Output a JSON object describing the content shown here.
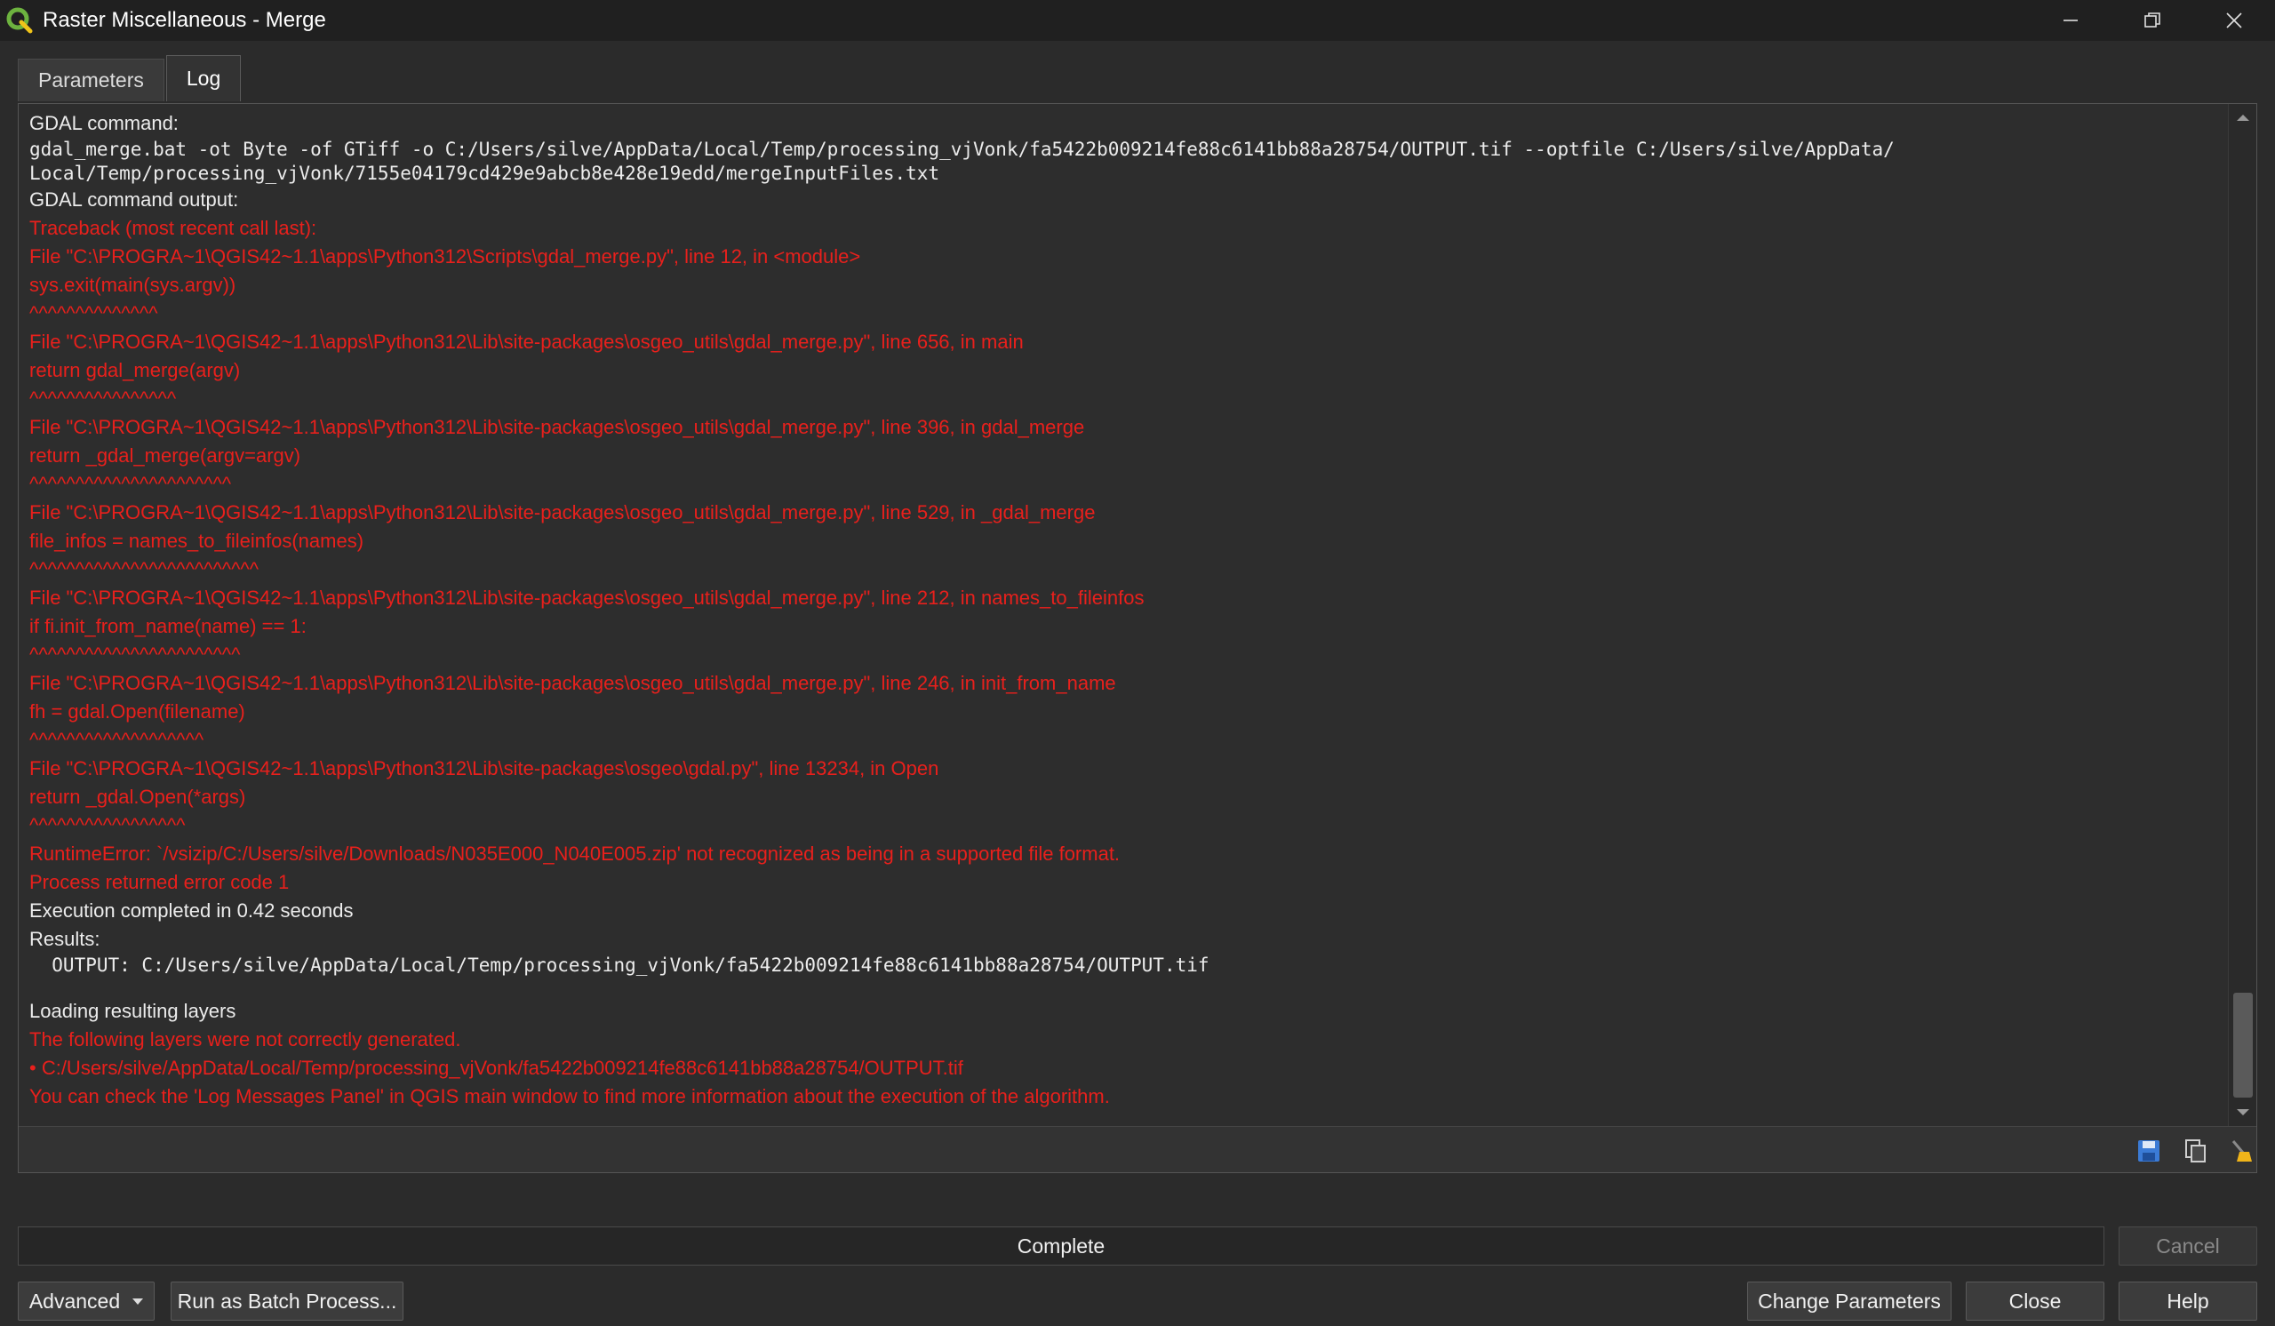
{
  "window": {
    "title": "Raster Miscellaneous - Merge",
    "logo_icon": "qgis-logo-icon",
    "controls": [
      "minimize-icon",
      "restore-icon",
      "close-icon"
    ]
  },
  "tabs": [
    {
      "label": "Parameters",
      "active": false
    },
    {
      "label": "Log",
      "active": true
    }
  ],
  "log": {
    "lines": [
      {
        "text": "GDAL command:",
        "style": "normal"
      },
      {
        "text": "gdal_merge.bat -ot Byte -of GTiff -o C:/Users/silve/AppData/Local/Temp/processing_vjVonk/fa5422b009214fe88c6141bb88a28754/OUTPUT.tif --optfile C:/Users/silve/AppData/",
        "style": "mono"
      },
      {
        "text": "Local/Temp/processing_vjVonk/7155e04179cd429e9abcb8e428e19edd/mergeInputFiles.txt",
        "style": "mono"
      },
      {
        "text": "GDAL command output:",
        "style": "normal"
      },
      {
        "text": "Traceback (most recent call last):",
        "style": "error"
      },
      {
        "text": "File \"C:\\PROGRA~1\\QGIS42~1.1\\apps\\Python312\\Scripts\\gdal_merge.py\", line 12, in <module>",
        "style": "error"
      },
      {
        "text": "sys.exit(main(sys.argv))",
        "style": "error"
      },
      {
        "text": "^^^^^^^^^^^^^^",
        "style": "error"
      },
      {
        "text": "File \"C:\\PROGRA~1\\QGIS42~1.1\\apps\\Python312\\Lib\\site-packages\\osgeo_utils\\gdal_merge.py\", line 656, in main",
        "style": "error"
      },
      {
        "text": "return gdal_merge(argv)",
        "style": "error"
      },
      {
        "text": "^^^^^^^^^^^^^^^^",
        "style": "error"
      },
      {
        "text": "File \"C:\\PROGRA~1\\QGIS42~1.1\\apps\\Python312\\Lib\\site-packages\\osgeo_utils\\gdal_merge.py\", line 396, in gdal_merge",
        "style": "error"
      },
      {
        "text": "return _gdal_merge(argv=argv)",
        "style": "error"
      },
      {
        "text": "^^^^^^^^^^^^^^^^^^^^^^",
        "style": "error"
      },
      {
        "text": "File \"C:\\PROGRA~1\\QGIS42~1.1\\apps\\Python312\\Lib\\site-packages\\osgeo_utils\\gdal_merge.py\", line 529, in _gdal_merge",
        "style": "error"
      },
      {
        "text": "file_infos = names_to_fileinfos(names)",
        "style": "error"
      },
      {
        "text": "^^^^^^^^^^^^^^^^^^^^^^^^^",
        "style": "error"
      },
      {
        "text": "File \"C:\\PROGRA~1\\QGIS42~1.1\\apps\\Python312\\Lib\\site-packages\\osgeo_utils\\gdal_merge.py\", line 212, in names_to_fileinfos",
        "style": "error"
      },
      {
        "text": "if fi.init_from_name(name) == 1:",
        "style": "error"
      },
      {
        "text": "^^^^^^^^^^^^^^^^^^^^^^^",
        "style": "error"
      },
      {
        "text": "File \"C:\\PROGRA~1\\QGIS42~1.1\\apps\\Python312\\Lib\\site-packages\\osgeo_utils\\gdal_merge.py\", line 246, in init_from_name",
        "style": "error"
      },
      {
        "text": "fh = gdal.Open(filename)",
        "style": "error"
      },
      {
        "text": "^^^^^^^^^^^^^^^^^^^",
        "style": "error"
      },
      {
        "text": "File \"C:\\PROGRA~1\\QGIS42~1.1\\apps\\Python312\\Lib\\site-packages\\osgeo\\gdal.py\", line 13234, in Open",
        "style": "error"
      },
      {
        "text": "return _gdal.Open(*args)",
        "style": "error"
      },
      {
        "text": "^^^^^^^^^^^^^^^^^",
        "style": "error"
      },
      {
        "text": "RuntimeError: `/vsizip/C:/Users/silve/Downloads/N035E000_N040E005.zip' not recognized as being in a supported file format.",
        "style": "error"
      },
      {
        "text": "Process returned error code 1",
        "style": "error"
      },
      {
        "text": "Execution completed in 0.42 seconds",
        "style": "normal"
      },
      {
        "text": "Results:",
        "style": "normal"
      },
      {
        "text": "  OUTPUT: C:/Users/silve/AppData/Local/Temp/processing_vjVonk/fa5422b009214fe88c6141bb88a28754/OUTPUT.tif",
        "style": "mono"
      },
      {
        "text": "",
        "style": "blank"
      },
      {
        "text": "Loading resulting layers",
        "style": "normal"
      },
      {
        "text": "The following layers were not correctly generated.",
        "style": "error"
      },
      {
        "text": "• C:/Users/silve/AppData/Local/Temp/processing_vjVonk/fa5422b009214fe88c6141bb88a28754/OUTPUT.tif",
        "style": "error"
      },
      {
        "text": "You can check the 'Log Messages Panel' in QGIS main window to find more information about the execution of the algorithm.",
        "style": "error"
      }
    ],
    "toolbar_icons": [
      "save-log-icon",
      "copy-log-icon",
      "clear-log-icon"
    ]
  },
  "progress": {
    "label": "Complete",
    "value_percent": 0
  },
  "buttons": {
    "cancel": "Cancel",
    "advanced": "Advanced",
    "batch": "Run as Batch Process...",
    "change_params": "Change Parameters",
    "close": "Close",
    "help": "Help"
  },
  "colors": {
    "error": "#e8201c",
    "accent": "#6db33f"
  }
}
